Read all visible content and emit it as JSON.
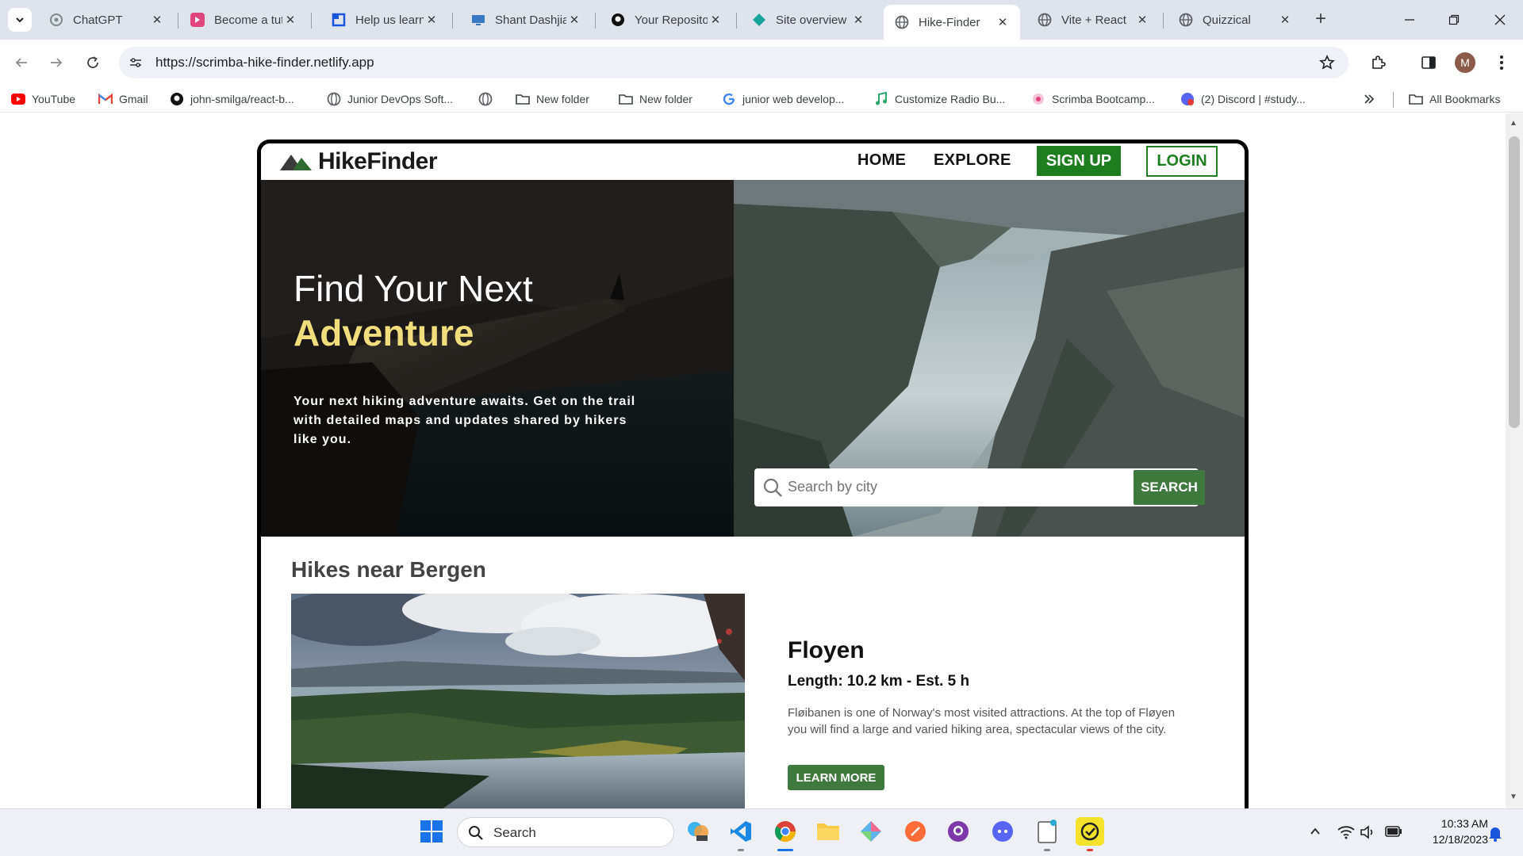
{
  "browser": {
    "tabs": [
      {
        "title": "ChatGPT",
        "icon": "chatgpt-icon",
        "color": "#7a8a84"
      },
      {
        "title": "Become a tut",
        "icon": "scrimba-icon",
        "color": "#e0457b"
      },
      {
        "title": "Help us learn",
        "icon": "forms-icon",
        "color": "#1a56db"
      },
      {
        "title": "Shant Dashjia",
        "icon": "monitor-icon",
        "color": "#3b78c4"
      },
      {
        "title": "Your Reposito",
        "icon": "github-icon",
        "color": "#111111"
      },
      {
        "title": "Site overview",
        "icon": "netlify-icon",
        "color": "#1aa39a"
      },
      {
        "title": "Hike-Finder",
        "icon": "globe-icon",
        "color": "#5f6368"
      },
      {
        "title": "Vite + React",
        "icon": "globe-icon",
        "color": "#5f6368"
      },
      {
        "title": "Quizzical",
        "icon": "globe-icon",
        "color": "#5f6368"
      }
    ],
    "url": "https://scrimba-hike-finder.netlify.app",
    "profile_initial": "M",
    "bookmarks": [
      {
        "label": "YouTube",
        "icon": "youtube-icon"
      },
      {
        "label": "Gmail",
        "icon": "gmail-icon"
      },
      {
        "label": "john-smilga/react-b...",
        "icon": "github-icon"
      },
      {
        "label": "Junior DevOps Soft...",
        "icon": "globe-icon"
      },
      {
        "label": "",
        "icon": "globe-icon"
      },
      {
        "label": "New folder",
        "icon": "folder-icon"
      },
      {
        "label": "New folder",
        "icon": "folder-icon"
      },
      {
        "label": "junior web develop...",
        "icon": "google-icon"
      },
      {
        "label": "Customize Radio Bu...",
        "icon": "music-icon"
      },
      {
        "label": "Scrimba Bootcamp...",
        "icon": "scrimba-icon"
      },
      {
        "label": "(2) Discord | #study...",
        "icon": "discord-icon"
      }
    ],
    "all_bookmarks": "All Bookmarks"
  },
  "site": {
    "logo": "HikeFinder",
    "nav": {
      "home": "HOME",
      "explore": "EXPLORE",
      "signup": "SIGN UP",
      "login": "LOGIN"
    },
    "hero": {
      "title_line1": "Find Your Next",
      "title_line2": "Adventure",
      "description": "Your next hiking adventure awaits. Get on the trail with detailed maps and updates shared by hikers like you.",
      "search_placeholder": "Search by city",
      "search_button": "SEARCH"
    },
    "section_title": "Hikes near Bergen",
    "hike": {
      "name": "Floyen",
      "length": "Length: 10.2 km - Est. 5 h",
      "description": "Fløibanen is one of Norway's most visited attractions. At the top of Fløyen you will find a large and varied hiking area, spectacular views of the city.",
      "cta": "LEARN MORE"
    }
  },
  "taskbar": {
    "search_label": "Search",
    "time": "10:33 AM",
    "date": "12/18/2023"
  },
  "colors": {
    "brand_green": "#1e7d1e",
    "button_green": "#3e7a3e",
    "accent_yellow": "#f0de7c"
  }
}
